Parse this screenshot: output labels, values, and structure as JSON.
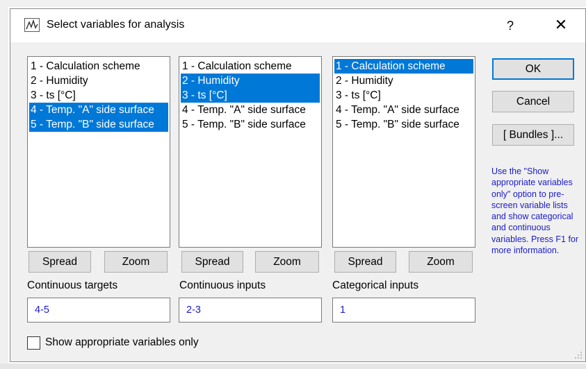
{
  "dialog": {
    "title": "Select variables for analysis",
    "help_label": "?",
    "close_label": "✕"
  },
  "lists": [
    {
      "items": [
        {
          "label": "1 - Calculation scheme",
          "selected": false
        },
        {
          "label": "2 - Humidity",
          "selected": false
        },
        {
          "label": "3 - ts [°C]",
          "selected": false
        },
        {
          "label": "4 - Temp. \"A\" side surface",
          "selected": true
        },
        {
          "label": "5 - Temp. \"B\" side surface",
          "selected": true
        }
      ],
      "spread_label": "Spread",
      "zoom_label": "Zoom",
      "group_label": "Continuous targets",
      "value": "4-5"
    },
    {
      "items": [
        {
          "label": "1 - Calculation scheme",
          "selected": false
        },
        {
          "label": "2 - Humidity",
          "selected": true
        },
        {
          "label": "3 - ts [°C]",
          "selected": true
        },
        {
          "label": "4 - Temp. \"A\" side surface",
          "selected": false
        },
        {
          "label": "5 - Temp. \"B\" side surface",
          "selected": false
        }
      ],
      "spread_label": "Spread",
      "zoom_label": "Zoom",
      "group_label": "Continuous inputs",
      "value": "2-3"
    },
    {
      "items": [
        {
          "label": "1 - Calculation scheme",
          "selected": true
        },
        {
          "label": "2 - Humidity",
          "selected": false
        },
        {
          "label": "3 - ts [°C]",
          "selected": false
        },
        {
          "label": "4 - Temp. \"A\" side surface",
          "selected": false
        },
        {
          "label": "5 - Temp. \"B\" side surface",
          "selected": false
        }
      ],
      "spread_label": "Spread",
      "zoom_label": "Zoom",
      "group_label": "Categorical inputs",
      "value": "1"
    }
  ],
  "buttons": {
    "ok_label": "OK",
    "cancel_label": "Cancel",
    "bundles_label": "[ Bundles ]..."
  },
  "hint": "Use the \"Show appropriate variables only\" option to pre-screen variable lists and show categorical and continuous variables. Press F1 for more information.",
  "checkbox": {
    "label": "Show appropriate variables only",
    "checked": false
  },
  "colors": {
    "selection": "#0078d7",
    "hint_text": "#1a1acc",
    "dialog_bg": "#f0f0f0"
  }
}
